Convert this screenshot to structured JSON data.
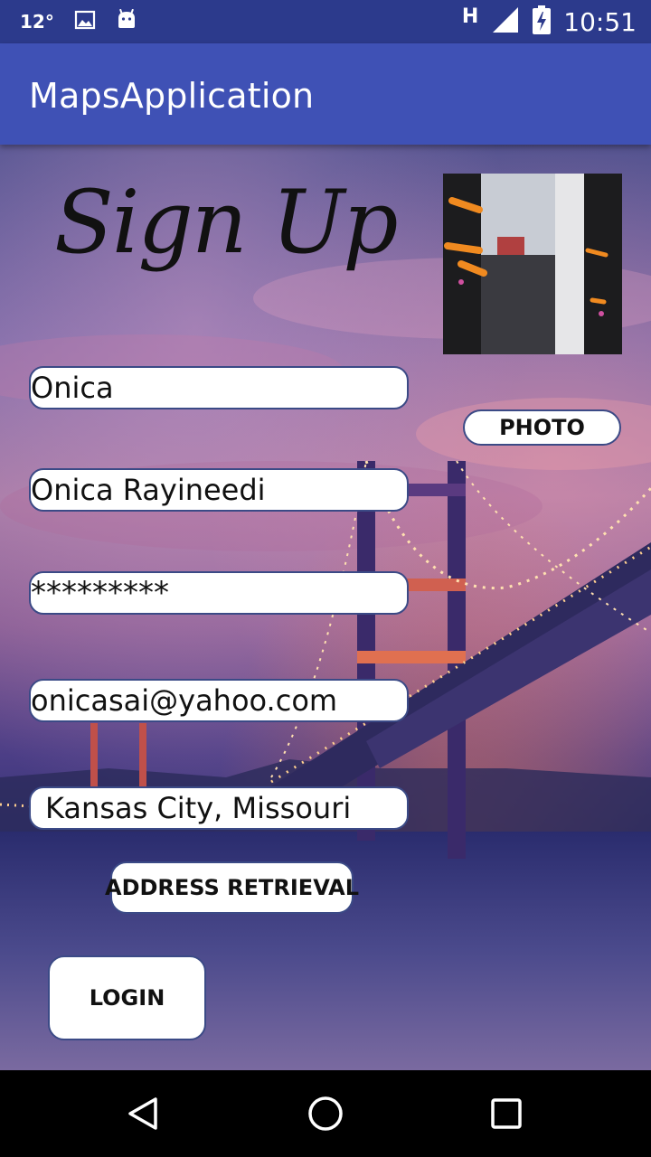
{
  "status_bar": {
    "temperature": "12°",
    "network_label": "H",
    "time": "10:51",
    "icons": [
      "gallery-icon",
      "android-icon",
      "signal-icon",
      "battery-charging-icon"
    ]
  },
  "app_bar": {
    "title": "MapsApplication"
  },
  "form": {
    "heading": "Sign Up",
    "photo_button_label": "PHOTO",
    "username_value": "Onica",
    "fullname_value": "Onica Rayineedi",
    "password_value": "*********",
    "email_value": "onicasai@yahoo.com",
    "address_value": "Kansas City, Missouri",
    "address_button_label": "ADDRESS RETRIEVAL",
    "login_button_label": "LOGIN"
  },
  "nav_bar": {
    "icons": [
      "back-icon",
      "home-icon",
      "recents-icon"
    ]
  },
  "colors": {
    "status_bar": "#2c3a8c",
    "app_bar": "#3f51b5",
    "field_border": "#3b4a86"
  }
}
